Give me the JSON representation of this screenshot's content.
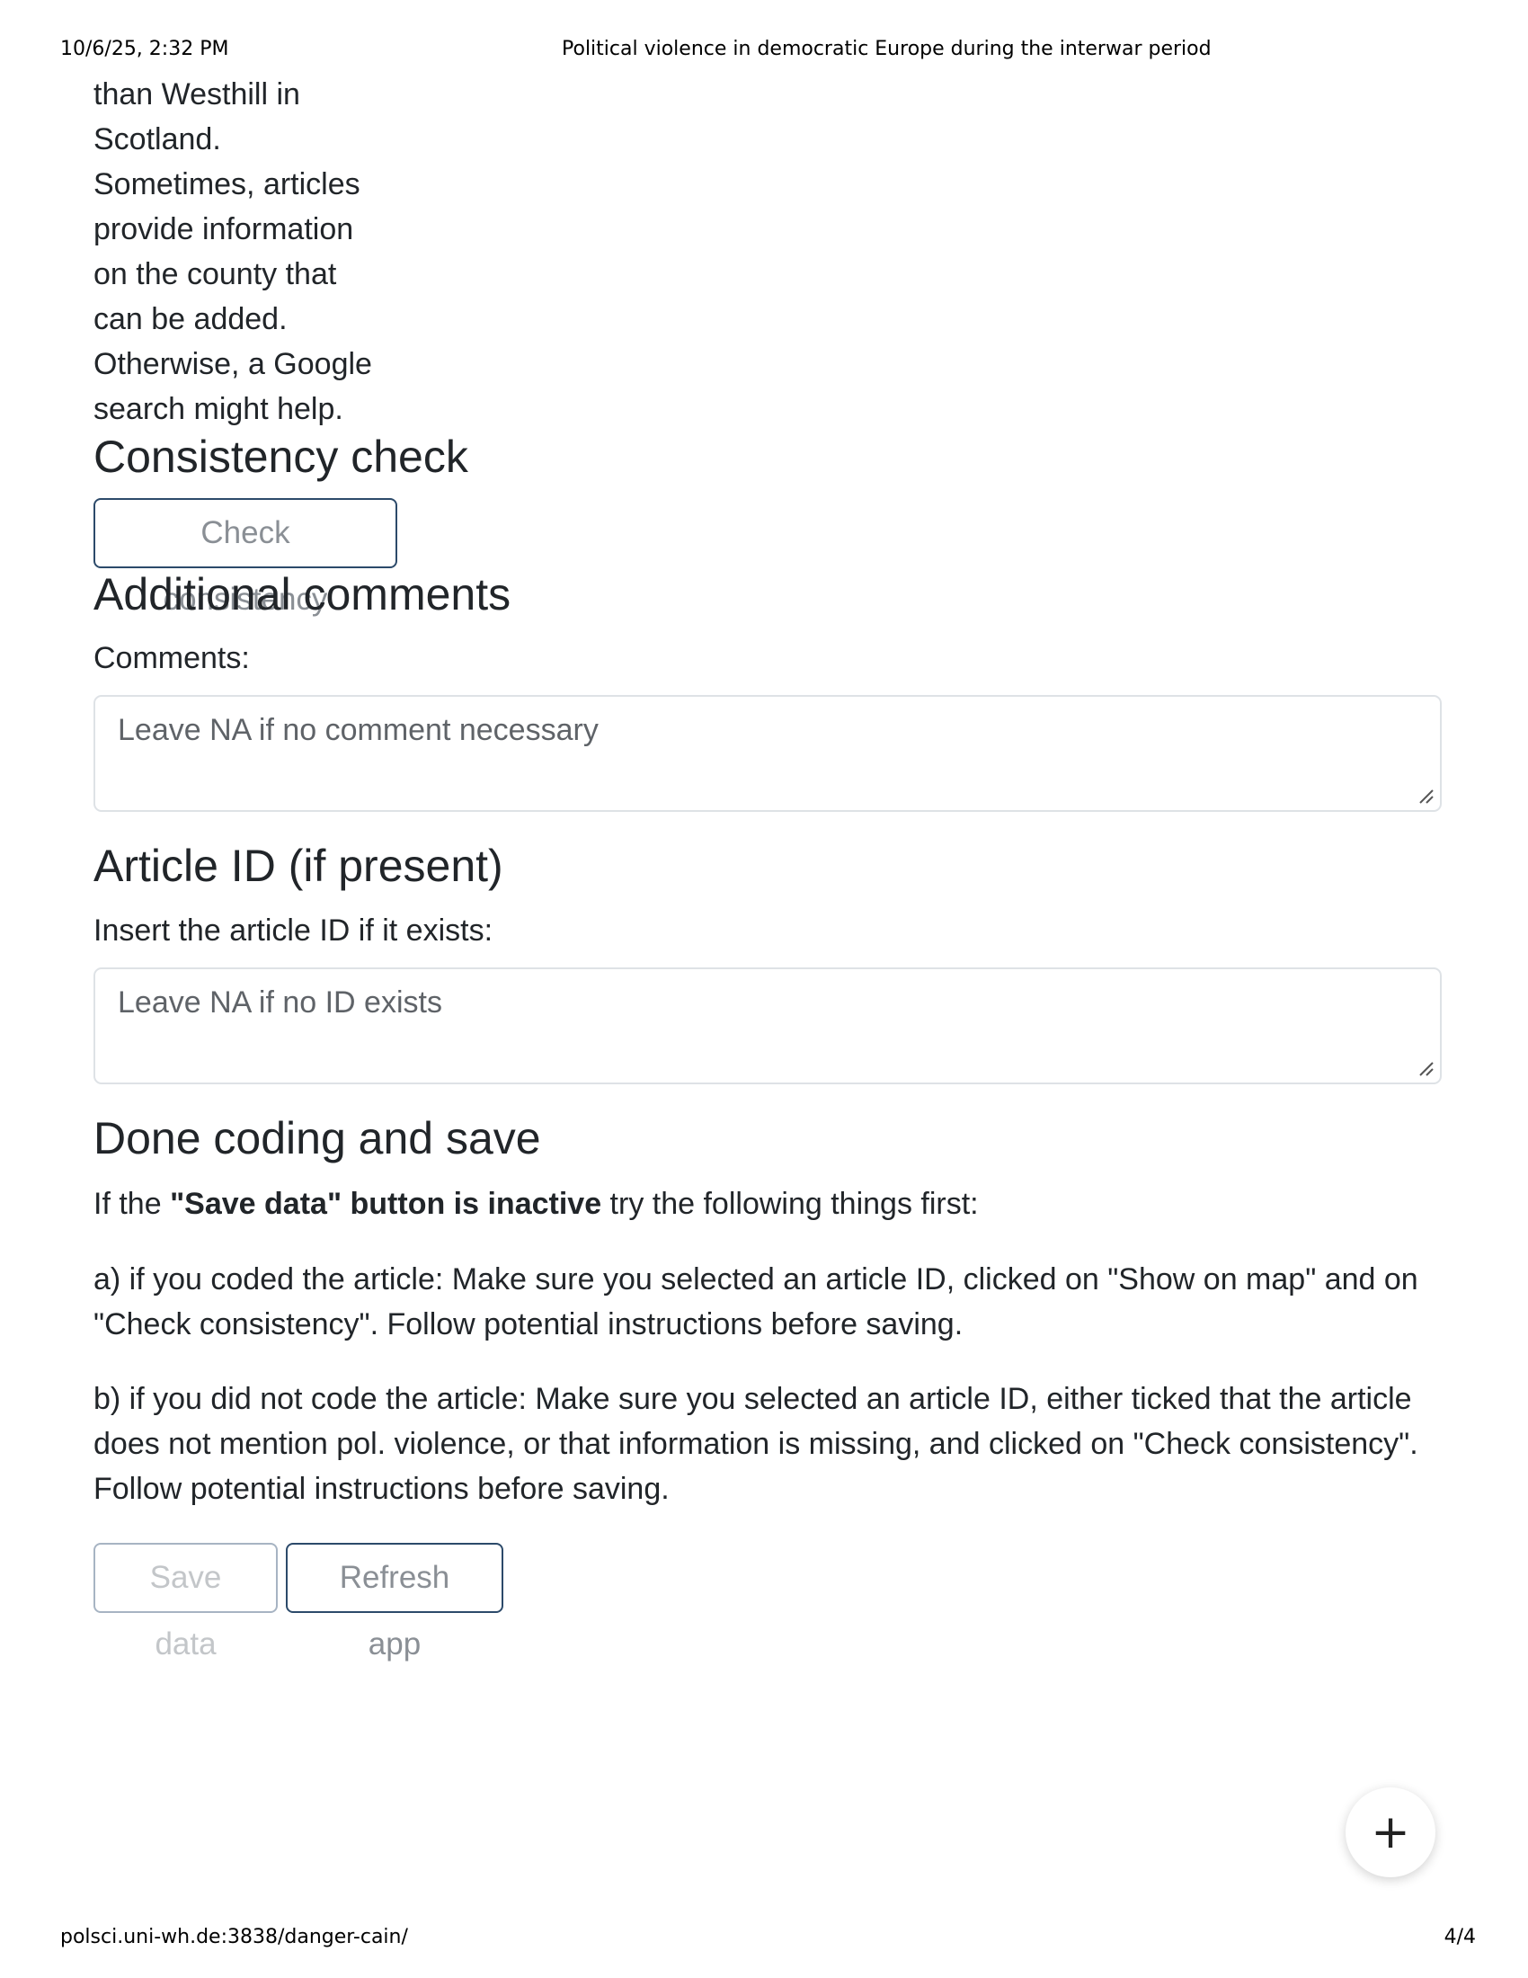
{
  "print_header": {
    "datetime": "10/6/25, 2:32 PM",
    "page_title": "Political violence in democratic Europe during the interwar period"
  },
  "print_footer": {
    "url": "polsci.uni-wh.de:3838/danger-cain/",
    "page_number": "4/4"
  },
  "location_note": {
    "lines": [
      "than Westhill in",
      "Scotland.",
      "Sometimes, articles",
      "provide information",
      "on the county that",
      "can be added.",
      "Otherwise, a Google",
      "search might help."
    ]
  },
  "consistency": {
    "heading": "Consistency check",
    "button_label": "Check consistency"
  },
  "comments": {
    "heading": "Additional comments",
    "label": "Comments:",
    "placeholder": "Leave NA if no comment necessary"
  },
  "article_id": {
    "heading": "Article ID (if present)",
    "label": "Insert the article ID if it exists:",
    "placeholder": "Leave NA if no ID exists"
  },
  "save_section": {
    "heading": "Done coding and save",
    "intro_prefix": "If the ",
    "intro_bold": "\"Save data\" button is inactive",
    "intro_suffix": " try the following things first:",
    "instruction_a": "a) if you coded the article: Make sure you selected an article ID, clicked on \"Show on map\" and on \"Check consistency\". Follow potential instructions before saving.",
    "instruction_b": "b) if you did not code the article: Make sure you selected an article ID, either ticked that the article does not mention pol. violence, or that information is missing, and clicked on \"Check consistency\". Follow potential instructions before saving.",
    "save_button_label": "Save data",
    "refresh_button_label": "Refresh app"
  },
  "fab": {
    "icon": "plus-icon",
    "glyph": "+"
  }
}
